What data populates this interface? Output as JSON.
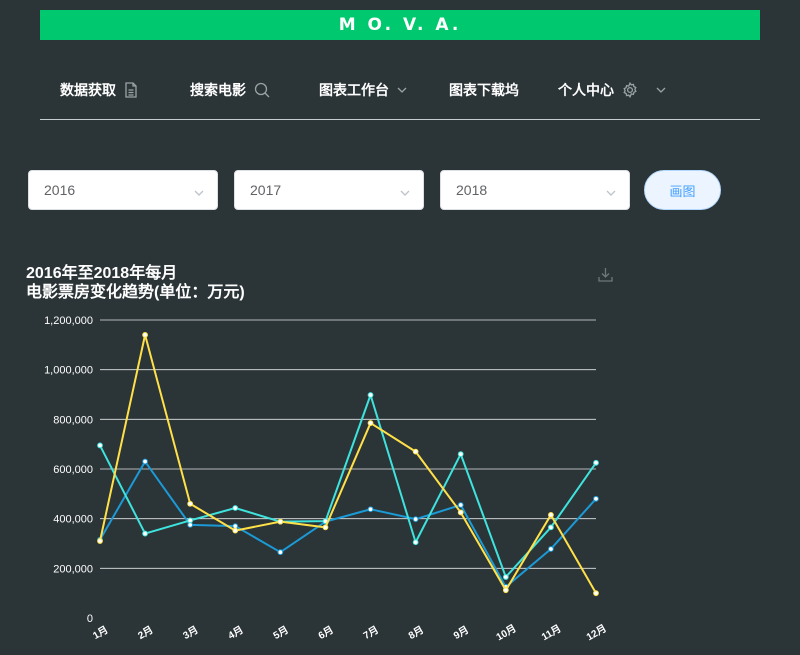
{
  "brand": {
    "title": "M O. V. A."
  },
  "nav": {
    "items": [
      {
        "label": "数据获取",
        "icon": "document-icon"
      },
      {
        "label": "搜索电影",
        "icon": "search-icon"
      },
      {
        "label": "图表工作台",
        "icon": "chevron-down-icon"
      },
      {
        "label": "图表下载坞",
        "icon": ""
      },
      {
        "label": "个人中心",
        "icon": "gear-icon"
      }
    ]
  },
  "selectors": [
    {
      "value": "2016"
    },
    {
      "value": "2017"
    },
    {
      "value": "2018"
    }
  ],
  "draw_button": {
    "label": "画图"
  },
  "colors": {
    "brand": "#00c86e",
    "background": "#2b3437",
    "series_2016": "#1b9ad6",
    "series_2017": "#3fe3dd",
    "series_2018": "#ffe049",
    "grid": "#e6e6e6"
  },
  "chart_data": {
    "type": "line",
    "title_line1": "2016年至2018年每月",
    "title_line2": "电影票房变化趋势(单位：万元)",
    "categories": [
      "1月",
      "2月",
      "3月",
      "4月",
      "5月",
      "6月",
      "7月",
      "8月",
      "9月",
      "10月",
      "11月",
      "12月"
    ],
    "y_ticks": [
      "0",
      "200,000",
      "400,000",
      "600,000",
      "800,000",
      "1,000,000",
      "1,200,000"
    ],
    "ylim": [
      0,
      1200000
    ],
    "grid": true,
    "series": [
      {
        "key": "2016",
        "values": [
          315000,
          630000,
          375000,
          370000,
          265000,
          388000,
          438000,
          398000,
          455000,
          125000,
          278000,
          480000
        ]
      },
      {
        "key": "2017",
        "values": [
          695000,
          340000,
          393000,
          443000,
          388000,
          390000,
          898000,
          305000,
          660000,
          165000,
          365000,
          625000
        ]
      },
      {
        "key": "2018",
        "values": [
          310000,
          1140000,
          460000,
          352000,
          388000,
          365000,
          785000,
          670000,
          425000,
          112000,
          415000,
          100000
        ]
      }
    ]
  }
}
